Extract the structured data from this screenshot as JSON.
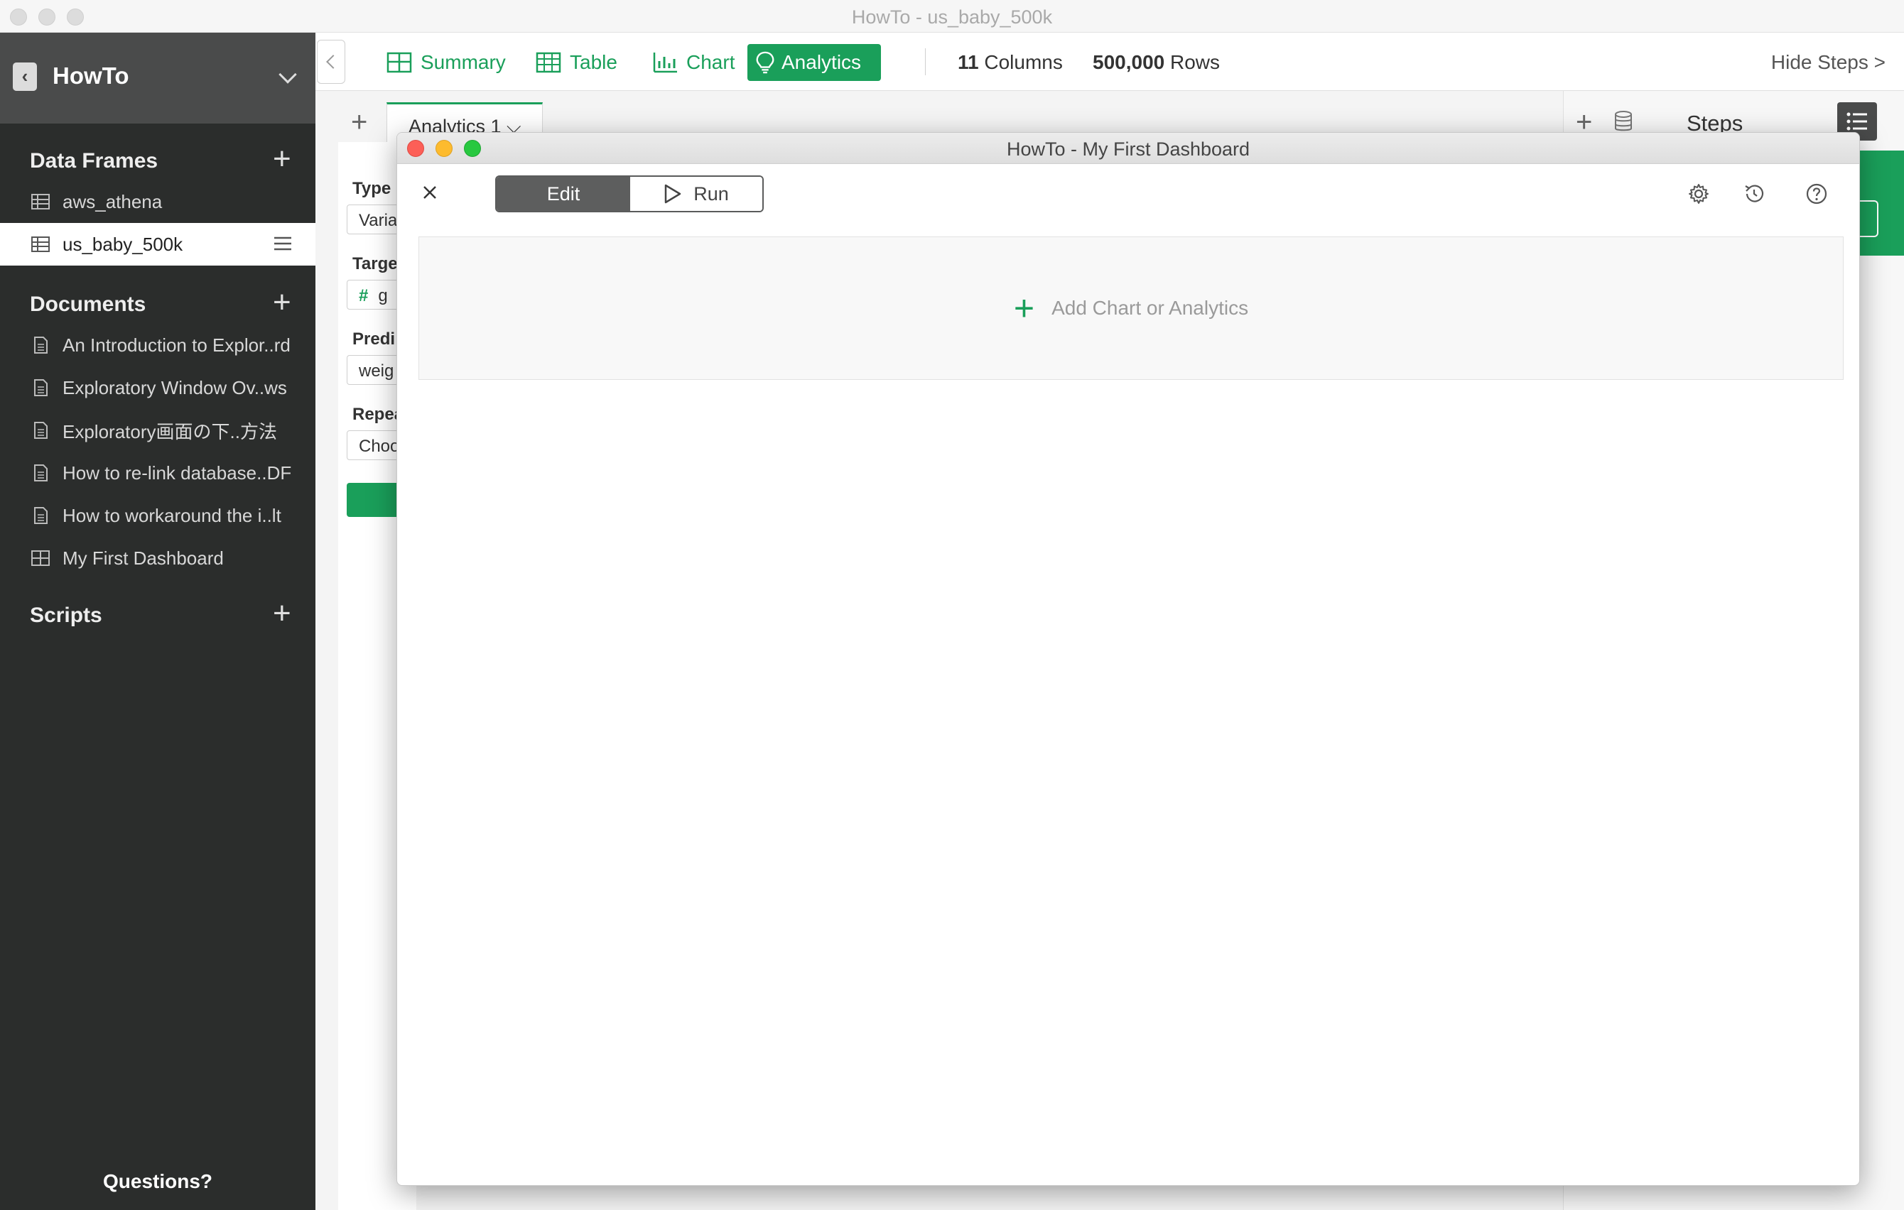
{
  "window": {
    "title": "HowTo - us_baby_500k"
  },
  "sidebar": {
    "project_name": "HowTo",
    "data_frames": {
      "label": "Data Frames",
      "items": [
        {
          "label": "aws_athena"
        },
        {
          "label": "us_baby_500k"
        }
      ]
    },
    "documents": {
      "label": "Documents",
      "items": [
        {
          "label": "An Introduction to Explor..rd"
        },
        {
          "label": "Exploratory Window Ov..ws"
        },
        {
          "label": "Exploratory画面の下..方法"
        },
        {
          "label": "How to re-link database..DF"
        },
        {
          "label": "How to workaround the i..lt"
        },
        {
          "label": "My First Dashboard"
        }
      ]
    },
    "scripts": {
      "label": "Scripts"
    },
    "questions": "Questions?"
  },
  "toolbar": {
    "tabs": [
      {
        "label": "Summary",
        "icon": "summary-icon"
      },
      {
        "label": "Table",
        "icon": "table-icon"
      },
      {
        "label": "Chart",
        "icon": "chart-icon"
      },
      {
        "label": "Analytics",
        "icon": "lightbulb-icon"
      }
    ],
    "columns_count": "11",
    "columns_label": "Columns",
    "rows_count": "500,000",
    "rows_label": "Rows",
    "hide_steps": "Hide Steps >"
  },
  "analytics_panel": {
    "tab_label": "Analytics 1 ⌵",
    "type_label": "Type",
    "type_value": "Varia",
    "target_label": "Targe",
    "target_value": "g",
    "predictor_label": "Predi",
    "predictor_value": "weig",
    "repeat_label": "Repea",
    "repeat_value": "Choo"
  },
  "steps": {
    "title": "Steps"
  },
  "dashboard": {
    "title": "HowTo - My First Dashboard",
    "edit_label": "Edit",
    "run_label": "Run",
    "add_label": "Add Chart or Analytics"
  },
  "colors": {
    "accent": "#1a9f5a",
    "sidebar_bg": "#2b2d2c",
    "sidebar_header": "#4a4b4b"
  }
}
